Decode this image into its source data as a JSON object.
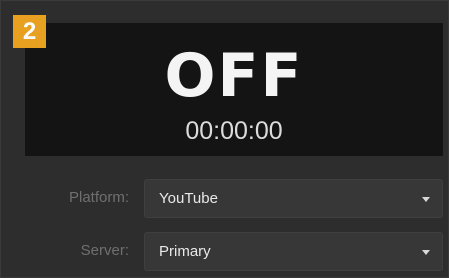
{
  "badge": {
    "number": "2"
  },
  "stream": {
    "status": "OFF",
    "timecode": "00:00:00"
  },
  "settings": {
    "platform": {
      "label": "Platform:",
      "value": "YouTube"
    },
    "server": {
      "label": "Server:",
      "value": "Primary"
    }
  },
  "colors": {
    "badge": "#e8a020",
    "display_background": "#141414",
    "panel_background": "#2d2d2d",
    "dropdown_background": "#373737"
  },
  "icons": {
    "dropdown": "chevron-down-icon"
  }
}
